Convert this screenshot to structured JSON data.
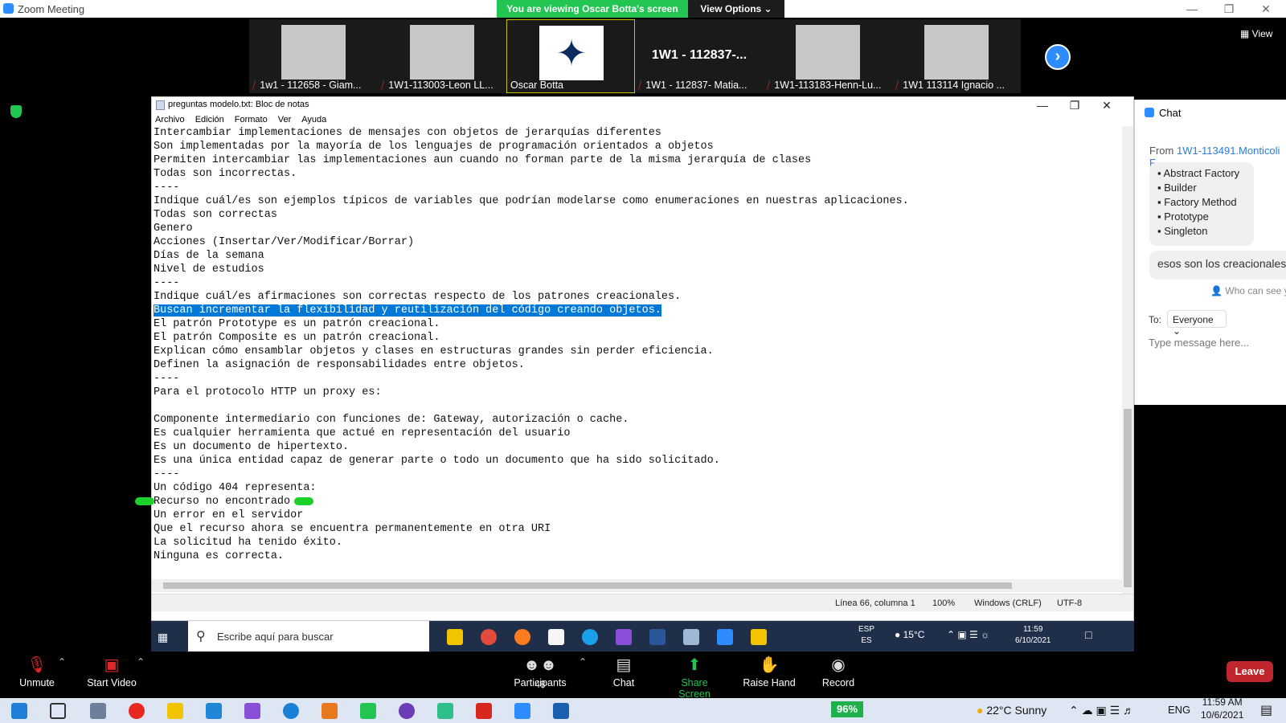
{
  "zoom": {
    "window_title": "Zoom Meeting",
    "viewing_banner": "You are viewing Oscar Botta's screen",
    "view_options": "View Options ⌄",
    "view_button": "View",
    "next_button": "›",
    "participants": [
      {
        "label": "1w1 - 112658 - Giam...",
        "muted": true,
        "type": "photo"
      },
      {
        "label": "1W1-113003-Leon LL...",
        "muted": true,
        "type": "photo"
      },
      {
        "label": "Oscar Botta",
        "muted": false,
        "type": "logo",
        "active": true
      },
      {
        "label": "1W1 - 112837- Matia...",
        "muted": true,
        "type": "name",
        "big_name": "1W1 - 112837-..."
      },
      {
        "label": "1W1-113183-Henn-Lu...",
        "muted": true,
        "type": "photo"
      },
      {
        "label": "1W1 113114 Ignacio ...",
        "muted": true,
        "type": "photo"
      }
    ],
    "controls": {
      "unmute": "Unmute",
      "start_video": "Start Video",
      "participants": "Participants",
      "participants_count": "48",
      "chat": "Chat",
      "share_screen": "Share Screen",
      "raise_hand": "Raise Hand",
      "record": "Record",
      "leave": "Leave"
    }
  },
  "notepad": {
    "title": "preguntas modelo.txt: Bloc de notas",
    "menu": [
      "Archivo",
      "Edición",
      "Formato",
      "Ver",
      "Ayuda"
    ],
    "lines": [
      "Intercambiar implementaciones de mensajes con objetos de jerarquías diferentes",
      "Son implementadas por la mayoría de los lenguajes de programación orientados a objetos",
      "Permiten intercambiar las implementaciones aun cuando no forman parte de la misma jerarquía de clases",
      "Todas son incorrectas.",
      "----",
      "Indique cuál/es son ejemplos típicos de variables que podrían modelarse como enumeraciones en nuestras aplicaciones.",
      "Todas son correctas",
      "Genero",
      "Acciones (Insertar/Ver/Modificar/Borrar)",
      "Días de la semana",
      "Nivel de estudios",
      "----",
      "Indique cuál/es afirmaciones son correctas respecto de los patrones creacionales.",
      "Buscan incrementar la flexibilidad y reutilización del código creando objetos.",
      "El patrón Prototype es un patrón creacional.",
      "El patrón Composite es un patrón creacional.",
      "Explican cómo ensamblar objetos y clases en estructuras grandes sin perder eficiencia.",
      "Definen la asignación de responsabilidades entre objetos.",
      "----",
      "Para el protocolo HTTP un proxy es:",
      "",
      "Componente intermediario con funciones de: Gateway, autorización o cache.",
      "Es cualquier herramienta que actué en representación del usuario",
      "Es un documento de hipertexto.",
      "Es una única entidad capaz de generar parte o todo un documento que ha sido solicitado.",
      "----",
      "Un código 404 representa:",
      "Recurso no encontrado",
      "Un error en el servidor",
      "Que el recurso ahora se encuentra permanentemente en otra URI",
      "La solicitud ha tenido éxito.",
      "Ninguna es correcta."
    ],
    "highlighted_line_index": 13,
    "status": {
      "position": "Línea 66, columna 1",
      "zoom": "100%",
      "line_ending": "Windows (CRLF)",
      "encoding": "UTF-8"
    }
  },
  "inner_taskbar": {
    "search_placeholder": "Escribe aquí para buscar",
    "weather": "15°C",
    "lang_top": "ESP",
    "lang_bottom": "ES",
    "time": "11:59",
    "date": "6/10/2021"
  },
  "chat": {
    "header": "Chat",
    "from_label": "From",
    "from_name": "1W1-113491.Monticoli F",
    "list_items": [
      "Abstract Factory",
      "Builder",
      "Factory Method",
      "Prototype",
      "Singleton"
    ],
    "message": "esos son los creacionales",
    "who_can_see": "Who can see yo",
    "to_label": "To:",
    "to_value": "Everyone ⌄",
    "input_placeholder": "Type message here..."
  },
  "outer_taskbar": {
    "battery": "96%",
    "weather": "22°C  Sunny",
    "lang": "ENG",
    "time": "11:59 AM",
    "date": "10/6/2021"
  }
}
